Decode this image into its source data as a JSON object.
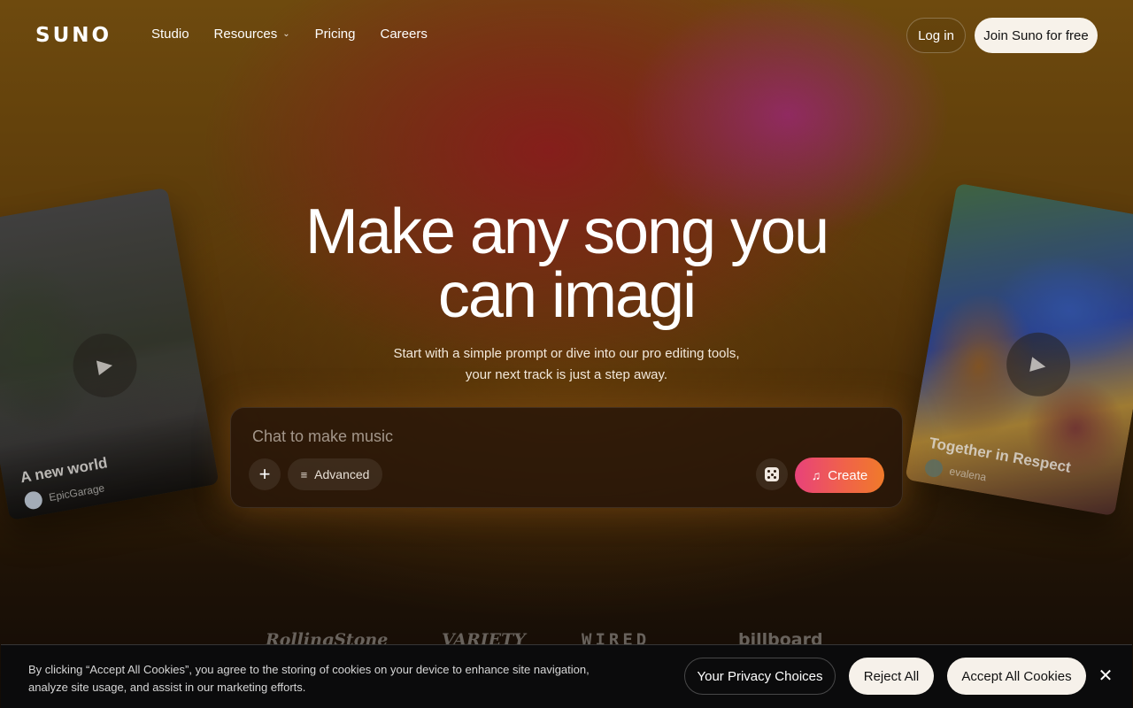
{
  "header": {
    "logo": "SUNO",
    "nav": [
      {
        "label": "Studio"
      },
      {
        "label": "Resources",
        "has_dropdown": true
      },
      {
        "label": "Pricing"
      },
      {
        "label": "Careers"
      }
    ],
    "login_label": "Log in",
    "join_label": "Join Suno for free"
  },
  "hero": {
    "title_line1": "Make any song you",
    "title_line2": "can imagi",
    "subtitle": "Start with a simple prompt or dive into our pro editing tools, your next track is just a step away."
  },
  "cards": {
    "left": {
      "title": "A new world",
      "artist": "EpicGarage"
    },
    "right": {
      "title": "Together in Respect",
      "artist": "evalena"
    }
  },
  "prompt": {
    "placeholder": "Chat to make music",
    "value": "",
    "advanced_label": "Advanced",
    "create_label": "Create"
  },
  "press": [
    "RollingStone",
    "VARIETY",
    "WIRED",
    "billboard"
  ],
  "cookie": {
    "text": "By clicking “Accept All Cookies”, you agree to the storing of cookies on your device to enhance site navigation, analyze site usage, and assist in our marketing efforts.",
    "privacy_label": "Your Privacy Choices",
    "reject_label": "Reject All",
    "accept_label": "Accept All Cookies"
  },
  "icons": {
    "resources_chevron": "chevron-down-icon",
    "plus": "plus-icon",
    "advanced": "sliders-icon",
    "dice": "dice-icon",
    "create": "music-note-icon",
    "play": "play-icon",
    "close": "close-icon"
  },
  "colors": {
    "create_gradient_start": "#e8427a",
    "create_gradient_end": "#f07a2a",
    "light_button": "#f7f2ea",
    "cookie_bar": "#0b0b0c"
  }
}
